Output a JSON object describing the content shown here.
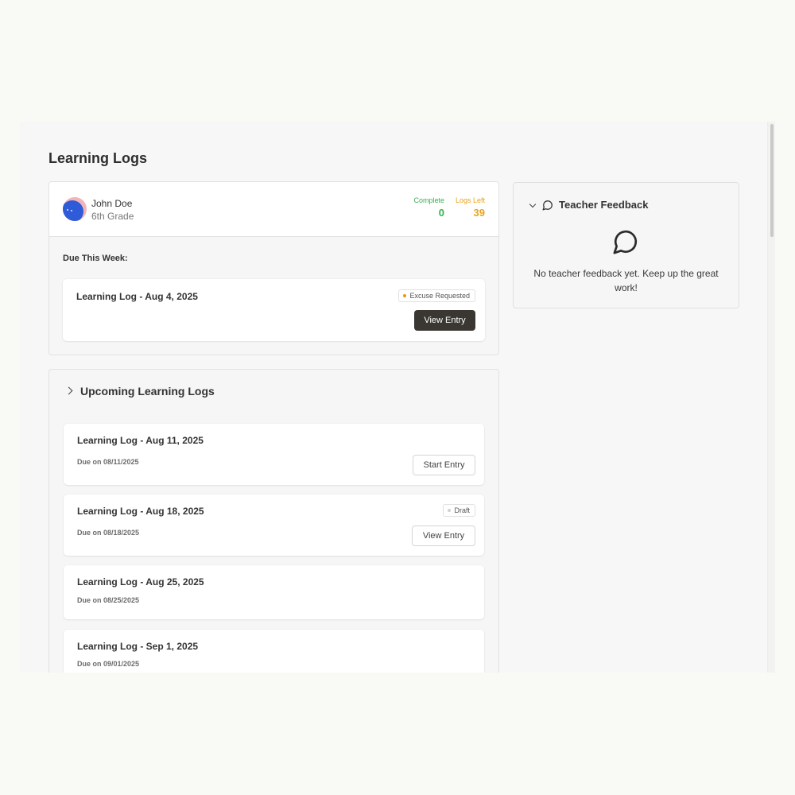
{
  "page": {
    "title": "Learning Logs"
  },
  "student": {
    "name": "John Doe",
    "grade": "6th Grade",
    "stats": {
      "complete_label": "Complete",
      "complete_value": "0",
      "left_label": "Logs Left",
      "left_value": "39"
    }
  },
  "due_this_week": {
    "label": "Due This Week:",
    "entry": {
      "title": "Learning Log - Aug 4, 2025",
      "badge": "Excuse Requested",
      "button": "View Entry"
    }
  },
  "upcoming": {
    "title": "Upcoming Learning Logs",
    "items": [
      {
        "title": "Learning Log - Aug 11, 2025",
        "due": "Due on 08/11/2025",
        "button": "Start Entry"
      },
      {
        "title": "Learning Log - Aug 18, 2025",
        "due": "Due on 08/18/2025",
        "badge": "Draft",
        "button": "View Entry"
      },
      {
        "title": "Learning Log - Aug 25, 2025",
        "due": "Due on 08/25/2025"
      },
      {
        "title": "Learning Log - Sep 1, 2025",
        "due": "Due on 09/01/2025"
      }
    ]
  },
  "feedback": {
    "title": "Teacher Feedback",
    "message": "No teacher feedback yet. Keep up the great work!"
  },
  "colors": {
    "complete": "#34b14f",
    "logs_left": "#e9a21a",
    "excuse_dot": "#e39b12",
    "draft_dot": "#d0d0d0",
    "dark_button": "#3a3733"
  }
}
